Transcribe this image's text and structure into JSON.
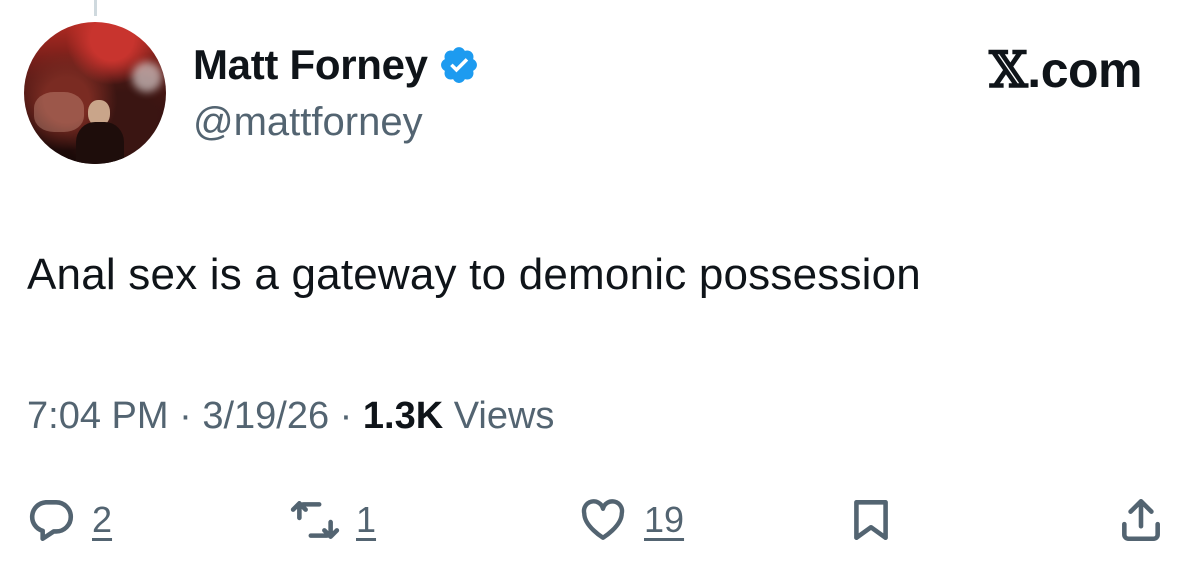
{
  "tweet": {
    "author_name": "Matt Forney",
    "handle": "@mattforney",
    "brand": {
      "glyph": "𝕏",
      "suffix": ".com"
    },
    "text": "Anal sex is a gateway to demonic possession",
    "time": "7:04 PM",
    "date": "3/19/26",
    "views_count": "1.3K",
    "views_label": "Views",
    "separator": " · "
  },
  "actions": {
    "reply_count": "2",
    "retweet_count": "1",
    "like_count": "19"
  },
  "colors": {
    "verified": "#1d9bf0",
    "muted": "#536471",
    "text": "#0f1419"
  },
  "icons": [
    "verified-badge-icon",
    "reply-icon",
    "retweet-icon",
    "like-icon",
    "bookmark-icon",
    "share-icon"
  ]
}
